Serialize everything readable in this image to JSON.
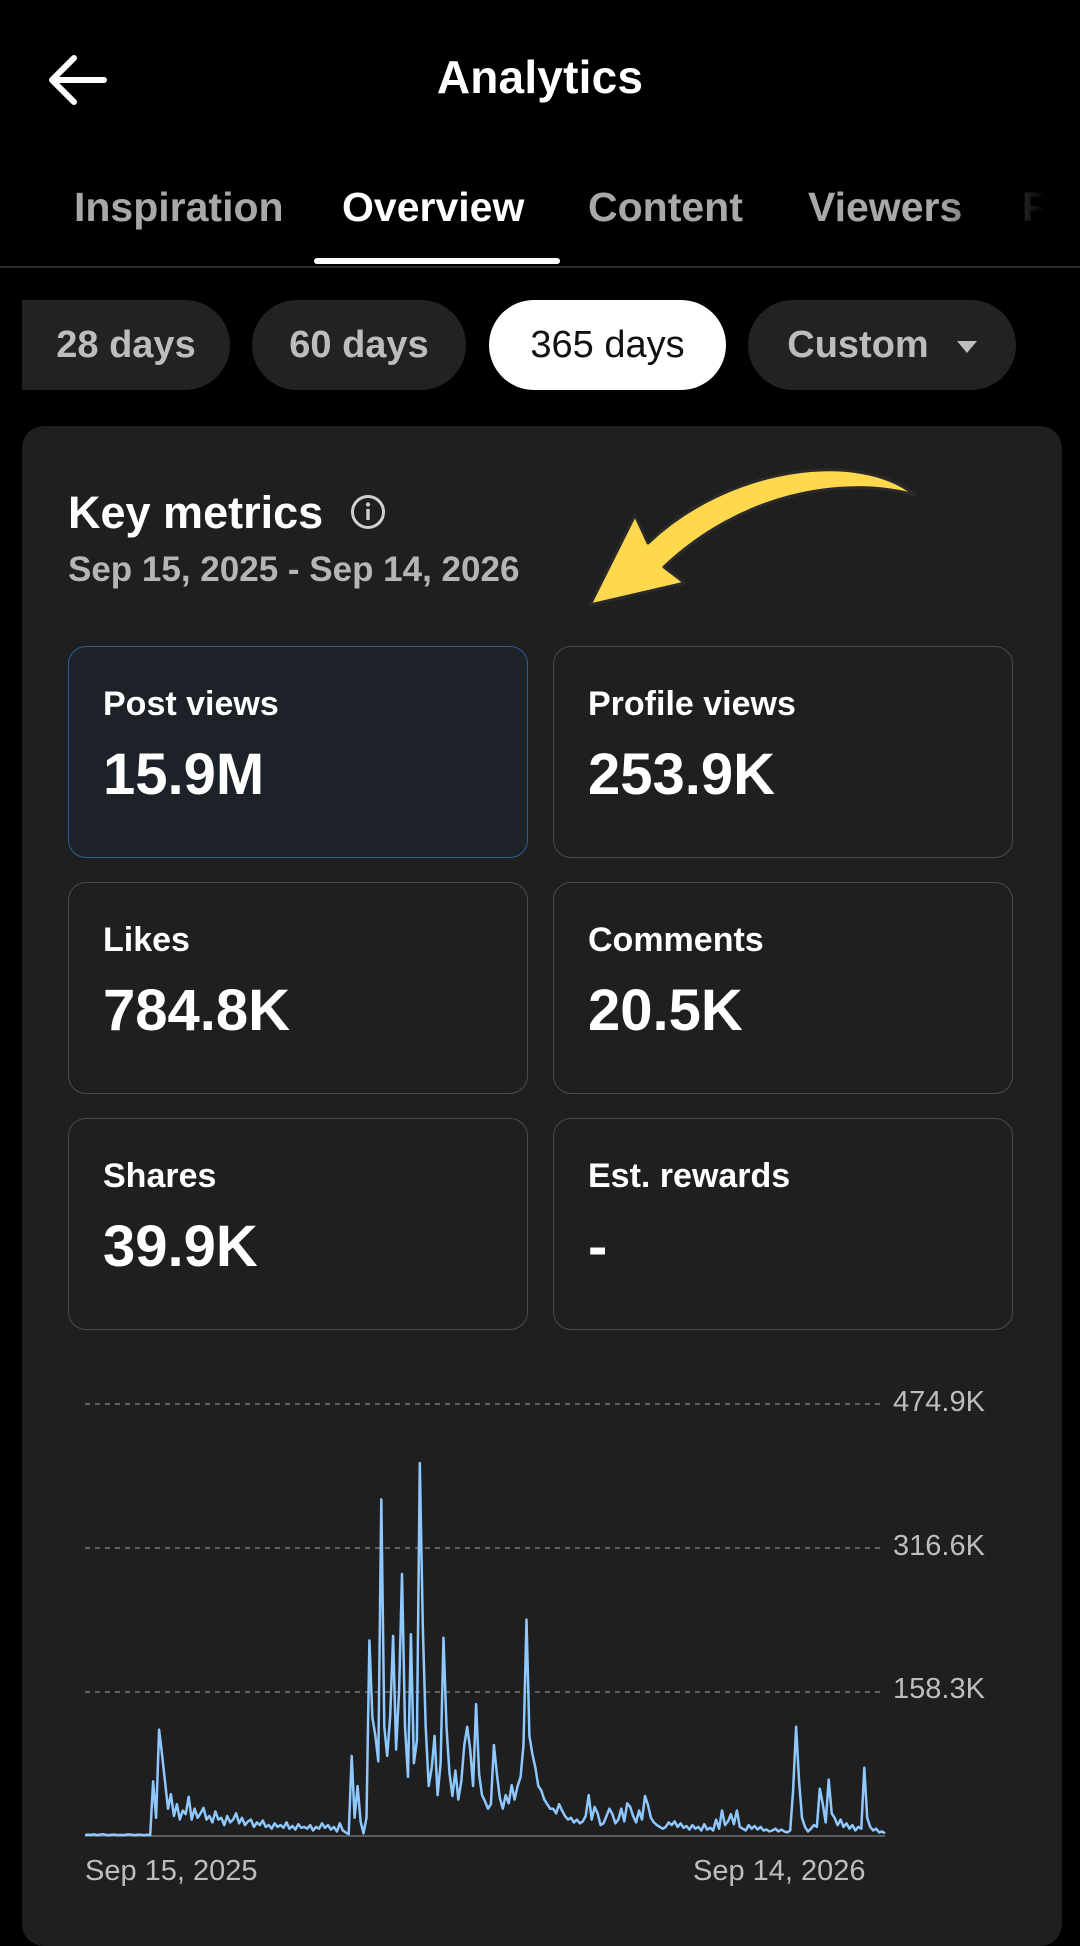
{
  "header": {
    "title": "Analytics",
    "back_icon": "back-arrow-icon"
  },
  "tabs": [
    {
      "label": "Inspiration",
      "active": false
    },
    {
      "label": "Overview",
      "active": true
    },
    {
      "label": "Content",
      "active": false
    },
    {
      "label": "Viewers",
      "active": false
    },
    {
      "label": "Followers",
      "active": false
    }
  ],
  "ranges": [
    {
      "label": "28 days",
      "active": false
    },
    {
      "label": "60 days",
      "active": false
    },
    {
      "label": "365 days",
      "active": true
    },
    {
      "label": "Custom",
      "active": false
    }
  ],
  "key_metrics": {
    "title": "Key metrics",
    "date_range": "Sep 15, 2025 - Sep 14, 2026",
    "items": [
      {
        "label": "Post views",
        "value": "15.9M",
        "selected": true
      },
      {
        "label": "Profile views",
        "value": "253.9K",
        "selected": false
      },
      {
        "label": "Likes",
        "value": "784.8K",
        "selected": false
      },
      {
        "label": "Comments",
        "value": "20.5K",
        "selected": false
      },
      {
        "label": "Shares",
        "value": "39.9K",
        "selected": false
      },
      {
        "label": "Est. rewards",
        "value": "-",
        "selected": false
      }
    ]
  },
  "colors": {
    "accent": "#8ec8ff",
    "arrow": "#ffd84d",
    "selected_border": "#2e5d96"
  },
  "chart_data": {
    "type": "line",
    "title": "",
    "xlabel": "",
    "ylabel": "",
    "x_tick_labels": [
      "Sep 15, 2025",
      "Sep 14, 2026"
    ],
    "y_tick_labels": [
      "474.9K",
      "316.6K",
      "158.3K"
    ],
    "ylim": [
      0,
      474900
    ],
    "grid": true,
    "series": [
      {
        "values": [
          1000,
          1500,
          1200,
          1800,
          1000,
          1500,
          2000,
          1200,
          1000,
          1300,
          1500,
          1000,
          1200,
          1000,
          1500,
          1800,
          1200,
          1000,
          1500,
          1200,
          1000,
          1300,
          1000,
          60000,
          20000,
          117000,
          90000,
          60000,
          30000,
          46000,
          22000,
          35000,
          18000,
          28000,
          24000,
          43000,
          18000,
          30000,
          20000,
          25000,
          31000,
          18000,
          22000,
          15000,
          27000,
          18000,
          20000,
          12000,
          22000,
          15000,
          18000,
          25000,
          14000,
          20000,
          12000,
          16000,
          18000,
          10000,
          15000,
          12000,
          17000,
          10000,
          12000,
          8000,
          14000,
          10000,
          12000,
          9000,
          15000,
          8000,
          11000,
          7000,
          13000,
          9000,
          10000,
          8000,
          12000,
          6000,
          10000,
          8000,
          14000,
          9000,
          12000,
          7000,
          10000,
          5000,
          14000,
          6000,
          4000,
          2000,
          88000,
          20000,
          55000,
          16000,
          3000,
          20000,
          215000,
          130000,
          110000,
          82000,
          370000,
          120000,
          88000,
          132000,
          220000,
          95000,
          160000,
          288000,
          120000,
          65000,
          222000,
          80000,
          105000,
          410000,
          230000,
          120000,
          55000,
          75000,
          110000,
          45000,
          80000,
          218000,
          120000,
          70000,
          44000,
          72000,
          40000,
          60000,
          100000,
          120000,
          95000,
          55000,
          145000,
          68000,
          45000,
          38000,
          30000,
          35000,
          100000,
          68000,
          42000,
          30000,
          45000,
          36000,
          56000,
          40000,
          55000,
          65000,
          100000,
          238000,
          110000,
          90000,
          75000,
          55000,
          50000,
          40000,
          35000,
          30000,
          30000,
          25000,
          35000,
          28000,
          22000,
          18000,
          20000,
          15000,
          18000,
          14000,
          16000,
          22000,
          45000,
          18000,
          32000,
          25000,
          12000,
          14000,
          22000,
          30000,
          24000,
          14000,
          18000,
          30000,
          16000,
          36000,
          32000,
          22000,
          15000,
          28000,
          18000,
          44000,
          34000,
          20000,
          15000,
          12000,
          10000,
          8000,
          10000,
          15000,
          12000,
          16000,
          10000,
          14000,
          9000,
          11000,
          7000,
          12000,
          8000,
          10000,
          6000,
          13000,
          7000,
          9000,
          6000,
          18000,
          8000,
          28000,
          12000,
          16000,
          24000,
          13000,
          28000,
          10000,
          8000,
          6000,
          12000,
          8000,
          11000,
          7000,
          10000,
          6000,
          7000,
          5000,
          6000,
          8000,
          5000,
          7000,
          5000,
          4000,
          6000,
          50000,
          120000,
          60000,
          20000,
          10000,
          5000,
          8000,
          12000,
          10000,
          52000,
          35000,
          15000,
          62000,
          25000,
          20000,
          12000,
          18000,
          10000,
          14000,
          8000,
          12000,
          6000,
          10000,
          8000,
          75000,
          20000,
          10000,
          6000,
          8000,
          4000,
          5000,
          3000
        ]
      }
    ]
  }
}
